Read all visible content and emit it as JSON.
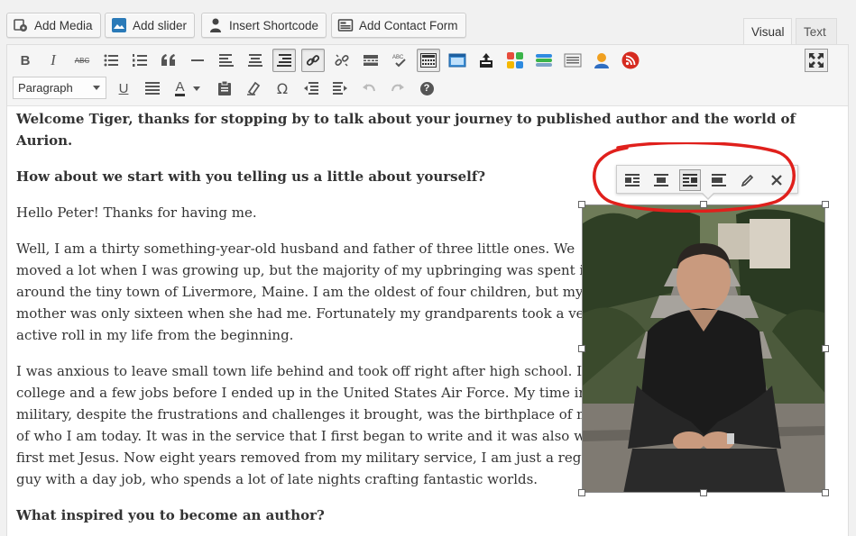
{
  "media_buttons": {
    "add_media": "Add Media",
    "add_slider": "Add slider",
    "insert_shortcode": "Insert Shortcode",
    "add_contact_form": "Add Contact Form"
  },
  "tabs": {
    "visual": "Visual",
    "text": "Text"
  },
  "toolbar": {
    "format_select_value": "Paragraph",
    "bold": "B",
    "italic": "I",
    "strike": "ABC",
    "underline": "U",
    "text_color": "A",
    "omega": "Ω",
    "help": "?"
  },
  "content": {
    "q1": "Welcome Tiger, thanks for stopping by to talk about your journey to published author and the world of",
    "q1b": "Aurion.",
    "q2": "How about we start with you telling us a little about yourself?",
    "p1": "Hello Peter! Thanks for having me.",
    "p2_lines": [
      "Well, I am a thirty something-year-old husband and father of three little ones. We",
      "moved a lot when I was growing up, but the majority of my upbringing was spent in and",
      "around the tiny town of Livermore, Maine. I am the oldest of four children, but my",
      "mother was only sixteen when she had me. Fortunately my grandparents took a very",
      "active roll in my life from the beginning."
    ],
    "p3_lines": [
      "I was anxious to leave small town life behind and took off right after high school. I tried",
      "college and a few jobs before I ended up in the United States Air Force. My time in the",
      "military, despite the frustrations and challenges it brought, was the birthplace of much",
      "of who I am today. It was in the service that I first began to write and it was also when I",
      "first met Jesus. Now eight years removed from my military service, I am just a regular",
      "guy with a day job, who spends a lot of late nights crafting fantastic worlds."
    ],
    "q3": "What inspired you to become an author?"
  },
  "colors": {
    "annotation": "#e0201c",
    "toolbar_bg": "#f5f5f5",
    "text": "#333333"
  }
}
